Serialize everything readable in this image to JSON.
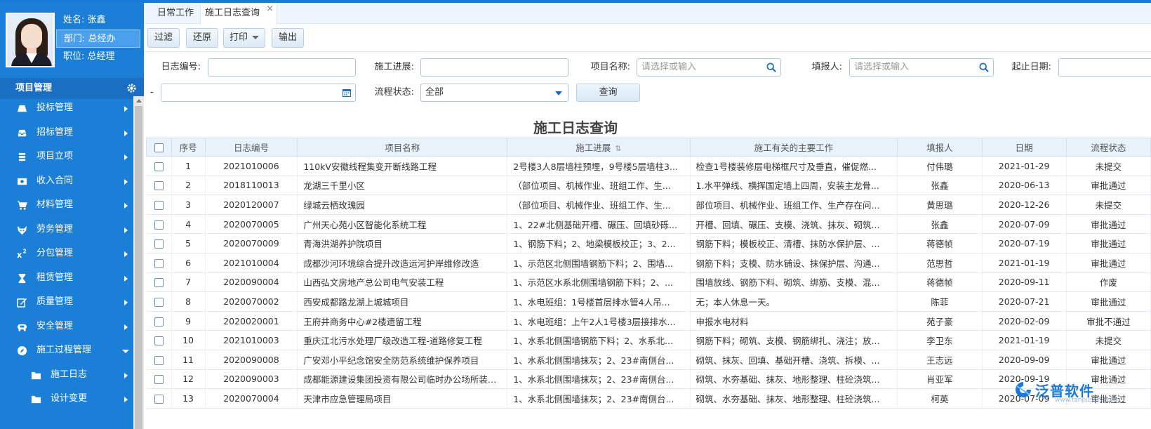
{
  "profile": {
    "name": "姓名: 张鑫",
    "dept": "部门: 总经办",
    "title": "职位: 总经理"
  },
  "menu_header": "项目管理",
  "menu": [
    {
      "label": "投标管理",
      "icon": "truck-icon"
    },
    {
      "label": "招标管理",
      "icon": "inbox-icon"
    },
    {
      "label": "项目立项",
      "icon": "stack-icon"
    },
    {
      "label": "收入合同",
      "icon": "money-icon"
    },
    {
      "label": "材料管理",
      "icon": "cart-icon"
    },
    {
      "label": "劳务管理",
      "icon": "fox-icon"
    },
    {
      "label": "分包管理",
      "icon": "superscript-icon"
    },
    {
      "label": "租赁管理",
      "icon": "hourglass-icon"
    },
    {
      "label": "质量管理",
      "icon": "edit-icon"
    },
    {
      "label": "安全管理",
      "icon": "ambulance-icon"
    },
    {
      "label": "施工过程管理",
      "icon": "compass-icon"
    }
  ],
  "submenu": [
    {
      "label": "施工日志",
      "icon": "folder-icon"
    },
    {
      "label": "设计变更",
      "icon": "folder-icon"
    }
  ],
  "tabs": [
    "日常工作",
    "施工日志查询"
  ],
  "tab_close": "×",
  "toolbar": {
    "filter": "过滤",
    "restore": "还原",
    "print": "打印",
    "export": "输出"
  },
  "form": {
    "log_no_label": "日志编号:",
    "progress_label": "施工进展:",
    "project_label": "项目名称:",
    "project_placeholder": "请选择或输入",
    "reporter_label": "填报人:",
    "reporter_placeholder": "请选择或输入",
    "date_label": "起止日期:",
    "dash": "-",
    "flow_label": "流程状态:",
    "flow_value": "全部",
    "query": "查询"
  },
  "report_title": "施工日志查询",
  "table": {
    "headers": [
      "序号",
      "日志编号",
      "项目名称",
      "施工进展",
      "施工有关的主要工作",
      "填报人",
      "日期",
      "流程状态"
    ],
    "sort_icon": "⇅",
    "rows": [
      {
        "no": "1",
        "code": "2021010006",
        "project": "110kV安徽线程集变开断线路工程",
        "progress": "2号楼3人8层墙柱预埋，9号楼5层墙柱3...",
        "work": "检查1号楼装修层电梯框尺寸及垂直，催促燃...",
        "reporter": "付伟璐",
        "date": "2021-01-29",
        "status": "未提交",
        "st": "sub"
      },
      {
        "no": "2",
        "code": "2018110013",
        "project": "龙湖三千里小区",
        "progress": "（部位项目、机械作业、班组工作、生...",
        "work": "1.水平弹线、横挥国定墙上四周，安装主龙骨...",
        "reporter": "张鑫",
        "date": "2020-06-13",
        "status": "审批通过",
        "st": "ok"
      },
      {
        "no": "3",
        "code": "2020120007",
        "project": "绿城云栖玫瑰园",
        "progress": "（部位项目、机械作业、班组工作、生...",
        "work": "部位项目、机械作业、班组工作、生产存在问...",
        "reporter": "黄思璐",
        "date": "2020-12-26",
        "status": "未提交",
        "st": "sub"
      },
      {
        "no": "4",
        "code": "2020070005",
        "project": "广州天心苑小区智能化系统工程",
        "progress": "1、22#北侧基础开槽、碾压、回填砂砾...",
        "work": "开槽、回填、碾压、支模、浇筑、抹灰、砌筑...",
        "reporter": "张鑫",
        "date": "2020-07-09",
        "status": "审批通过",
        "st": "ok"
      },
      {
        "no": "5",
        "code": "2020070009",
        "project": "青海洪湖养护院项目",
        "progress": "1、钢筋下料；2、地梁模板校正；3、2...",
        "work": "钢筋下料；模板校正、清槽、抹防水保护层、...",
        "reporter": "蒋德帧",
        "date": "2020-07-19",
        "status": "审批通过",
        "st": "ok"
      },
      {
        "no": "6",
        "code": "2021010004",
        "project": "成都沙河环境综合提升改造运河护岸维修改造",
        "progress": "1、示范区北侧围墙钢筋下料；2、围墙...",
        "work": "钢筋下料；支模、防水铺设、抹保护层、沟通...",
        "reporter": "范思哲",
        "date": "2021-01-19",
        "status": "审批通过",
        "st": "ok"
      },
      {
        "no": "7",
        "code": "2020090004",
        "project": "山西弘文房地产总公司电气安装工程",
        "progress": "1、示范区水系北侧围墙钢筋下料；2、...",
        "work": "围墙放线、钢筋下料、砌筑、绑筋、支模、混...",
        "reporter": "蒋德帧",
        "date": "2020-09-11",
        "status": "作废",
        "st": "void"
      },
      {
        "no": "8",
        "code": "2020070002",
        "project": "西安成都路龙湖上城城项目",
        "progress": "1、水电班组：1号楼首层排水管4人吊...",
        "work": "无；本人休息一天。",
        "reporter": "陈菲",
        "date": "2020-07-21",
        "status": "审批通过",
        "st": "ok"
      },
      {
        "no": "9",
        "code": "2020020001",
        "project": "王府井商务中心#2楼遗留工程",
        "progress": "1、水电班组：上午2人1号楼3层接排水...",
        "work": "申报水电材料",
        "reporter": "苑子豪",
        "date": "2020-02-09",
        "status": "审批不通过",
        "st": "no"
      },
      {
        "no": "10",
        "code": "2021010003",
        "project": "重庆江北污水处理厂级改造工程-道路修复工程",
        "progress": "1、水系北侧围墙钢筋下料；2、水系北...",
        "work": "钢筋下料；砌筑、支模、钢筋绑扎、浇注；放...",
        "reporter": "李卫东",
        "date": "2021-01-19",
        "status": "未提交",
        "st": "sub"
      },
      {
        "no": "11",
        "code": "2020090008",
        "project": "广安邓小平纪念馆安全防范系统维护保养项目",
        "progress": "1、水系北侧围墙抹灰；2、23#南侧台...",
        "work": "砌筑、抹灰、回填、基础开槽、浇筑、拆模、...",
        "reporter": "王志远",
        "date": "2020-09-09",
        "status": "审批通过",
        "st": "ok"
      },
      {
        "no": "12",
        "code": "2020090003",
        "project": "成都能源建设集团投资有限公司临时办公场所装修工程",
        "progress": "1、水系北侧围墙抹灰；2、23#南侧台...",
        "work": "砌筑、水夯基础、抹灰、地形整理、柱砼浇筑...",
        "reporter": "肖亚军",
        "date": "2020-09-19",
        "status": "审批通过",
        "st": "ok"
      },
      {
        "no": "13",
        "code": "2020070004",
        "project": "天津市应急管理局项目",
        "progress": "1、水系北侧围墙抹灰；2、23#南侧台...",
        "work": "砌筑、水夯基础、抹灰、地形整理、柱砼浇筑...",
        "reporter": "柯英",
        "date": "2020-07-09",
        "status": "审批通过",
        "st": "ok"
      }
    ]
  },
  "watermark": {
    "text": "泛普软件",
    "url": "www.fanpusoft.com"
  },
  "colors": {
    "sidebar": "#1b7fd8",
    "accent": "#1a6fc4",
    "approved": "#1b8a1b",
    "rejected": "#e01e1e",
    "unsubmitted": "#1a1acc",
    "void": "#8b2a8b"
  }
}
